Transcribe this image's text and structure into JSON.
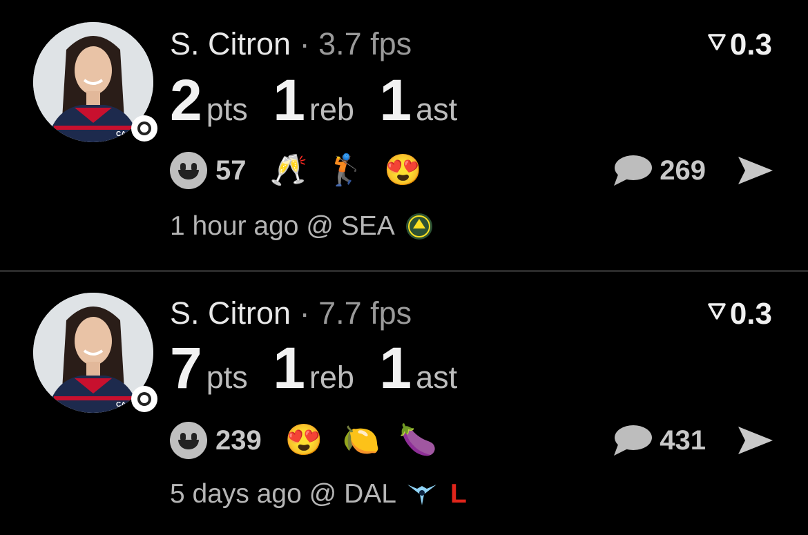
{
  "posts": [
    {
      "player": "S. Citron",
      "separator": "·",
      "fps": "3.7 fps",
      "score": "0.3",
      "stats": [
        {
          "value": "2",
          "unit": "pts"
        },
        {
          "value": "1",
          "unit": "reb"
        },
        {
          "value": "1",
          "unit": "ast"
        }
      ],
      "reaction_count": "57",
      "reaction_emojis": [
        "🥂",
        "🏌️",
        "😍"
      ],
      "comment_count": "269",
      "time": "1 hour ago @ SEA",
      "opponent_logo": "seattle-storm-logo",
      "result": ""
    },
    {
      "player": "S. Citron",
      "separator": "·",
      "fps": "7.7 fps",
      "score": "0.3",
      "stats": [
        {
          "value": "7",
          "unit": "pts"
        },
        {
          "value": "1",
          "unit": "reb"
        },
        {
          "value": "1",
          "unit": "ast"
        }
      ],
      "reaction_count": "239",
      "reaction_emojis": [
        "😍",
        "🍋",
        "🍆"
      ],
      "comment_count": "431",
      "time": "5 days ago @ DAL",
      "opponent_logo": "dallas-wings-logo",
      "result": "L"
    }
  ],
  "colors": {
    "background": "#000000",
    "divider": "#2a2a2a",
    "loss_red": "#e0251b",
    "muted_text": "#9a9a9a"
  }
}
